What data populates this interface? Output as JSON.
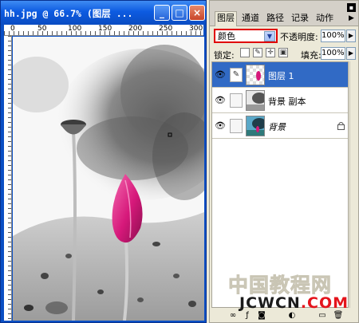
{
  "document": {
    "title": "hh.jpg @ 66.7% (图层 ...",
    "window_buttons": {
      "minimize": "_",
      "maximize": "□",
      "close": "×"
    },
    "ruler_top_labels": [
      "0",
      "50",
      "100",
      "150",
      "200",
      "250",
      "300"
    ]
  },
  "layers_panel": {
    "tabs": [
      "图层",
      "通道",
      "路径",
      "记录",
      "动作"
    ],
    "active_tab": "图层",
    "blend_mode": "颜色",
    "opacity_label": "不透明度:",
    "opacity_value": "100%",
    "lock_label": "锁定:",
    "fill_label": "填充:",
    "fill_value": "100%",
    "layers": [
      {
        "name": "图层 1",
        "visible": true,
        "selected": true,
        "locked": false
      },
      {
        "name": "背景 副本",
        "visible": true,
        "selected": false,
        "locked": false
      },
      {
        "name": "背景",
        "visible": true,
        "selected": false,
        "locked": true
      }
    ]
  },
  "watermark": {
    "line1": "中国教程网",
    "line2a": "JCWCN",
    "line2b": ".COM"
  },
  "colors": {
    "selection": "#316ac5",
    "highlight_border": "#e00000",
    "flower": "#d6187a"
  }
}
